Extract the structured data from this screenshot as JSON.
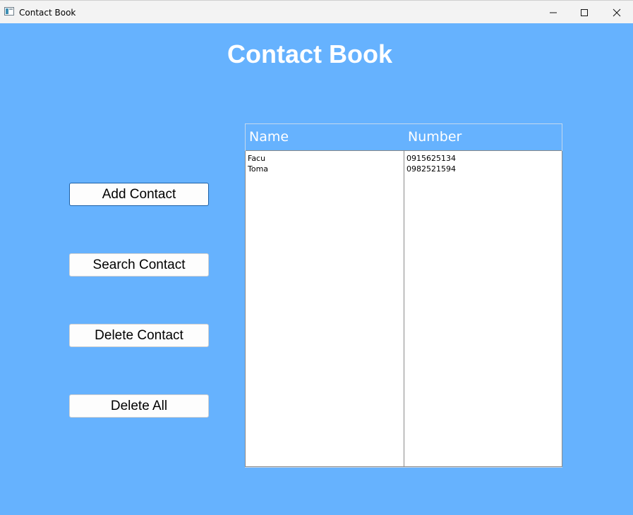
{
  "window": {
    "title": "Contact Book",
    "controls": {
      "minimize_icon": "minimize-icon",
      "maximize_icon": "maximize-icon",
      "close_icon": "close-icon"
    }
  },
  "main": {
    "heading": "Contact Book",
    "background_color": "#66b2fe"
  },
  "actions": {
    "add_label": "Add Contact",
    "search_label": "Search Contact",
    "delete_label": "Delete Contact",
    "delete_all_label": "Delete All"
  },
  "table": {
    "columns": [
      "Name",
      "Number"
    ],
    "rows": [
      {
        "name": "Facu",
        "number": "0915625134"
      },
      {
        "name": "Toma",
        "number": "0982521594"
      }
    ]
  }
}
